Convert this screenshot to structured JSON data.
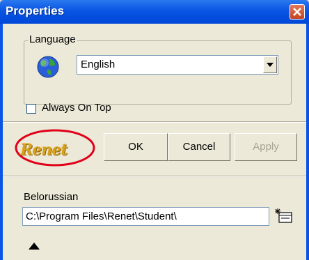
{
  "window": {
    "title": "Properties"
  },
  "language_group": {
    "legend": "Language",
    "selected_language": "English",
    "icon": "globe-icon"
  },
  "always_on_top": {
    "label": "Always On Top",
    "checked": false
  },
  "logo": {
    "text": "Renet"
  },
  "buttons": {
    "ok": "OK",
    "cancel": "Cancel",
    "apply": "Apply"
  },
  "translation": {
    "label": "Belorussian",
    "path": "C:\\Program Files\\Renet\\Student\\"
  },
  "colors": {
    "titlebar": "#0a55e3",
    "dialog_bg": "#ece9d8",
    "logo_highlight": "#e0001a",
    "logo_text": "#d9a21e"
  }
}
